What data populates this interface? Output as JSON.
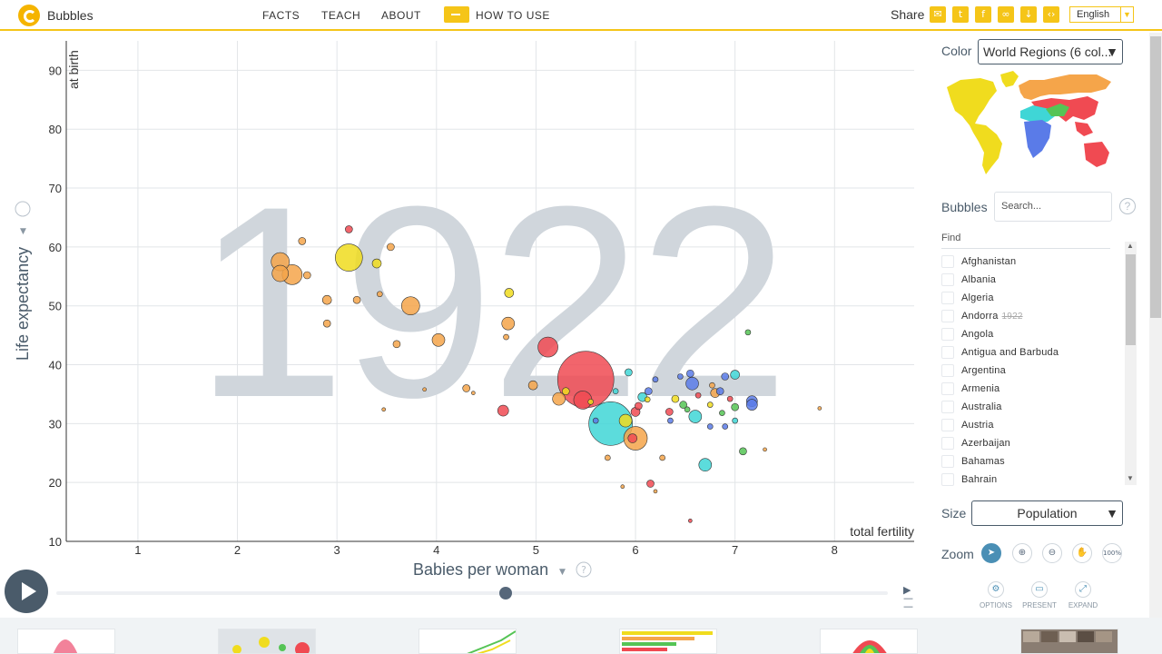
{
  "header": {
    "brand": "Bubbles",
    "nav": [
      "FACTS",
      "TEACH",
      "ABOUT"
    ],
    "howto": "HOW TO USE",
    "share": "Share",
    "share_icons": [
      "mail-icon",
      "twitter-icon",
      "facebook-icon",
      "link-icon",
      "download-icon",
      "embed-icon"
    ],
    "language": "English"
  },
  "chart_data": {
    "type": "scatter",
    "year": "1922",
    "xlabel": "Babies per woman",
    "xlabel_sub": "total fertility",
    "ylabel": "Life expectancy",
    "ylabel_sub": "at birth",
    "x_ticks": [
      "1",
      "2",
      "3",
      "4",
      "5",
      "6",
      "7",
      "8"
    ],
    "y_ticks": [
      "10",
      "20",
      "30",
      "40",
      "50",
      "60",
      "70",
      "80",
      "90"
    ],
    "xlim": [
      0.28,
      8.8
    ],
    "ylim": [
      10,
      95
    ],
    "region_colors": {
      "americas": "#f0dc1e",
      "europe": "#f5a54a",
      "africa": "#3fd6d6",
      "asia": "#f04a52",
      "east_asia": "#f04a52",
      "oceania": "#5a7be8",
      "mena": "#3fd6d6",
      "south_asia": "#55c455"
    },
    "bubbles": [
      {
        "x": 5.5,
        "y": 37.5,
        "r": 31,
        "c": "#f04a52"
      },
      {
        "x": 5.75,
        "y": 30,
        "r": 24,
        "c": "#3fd6d6"
      },
      {
        "x": 3.12,
        "y": 58.2,
        "r": 15,
        "c": "#f0dc1e"
      },
      {
        "x": 5.12,
        "y": 43,
        "r": 11,
        "c": "#f04a52"
      },
      {
        "x": 5.47,
        "y": 34,
        "r": 10,
        "c": "#f04a52"
      },
      {
        "x": 6.0,
        "y": 27.5,
        "r": 13,
        "c": "#f5a54a"
      },
      {
        "x": 2.43,
        "y": 57.5,
        "r": 10,
        "c": "#f5a54a"
      },
      {
        "x": 2.55,
        "y": 55.3,
        "r": 11,
        "c": "#f5a54a"
      },
      {
        "x": 2.43,
        "y": 55.5,
        "r": 9,
        "c": "#f5a54a"
      },
      {
        "x": 3.74,
        "y": 50,
        "r": 10,
        "c": "#f5a54a"
      },
      {
        "x": 4.02,
        "y": 44.2,
        "r": 7,
        "c": "#f5a54a"
      },
      {
        "x": 4.72,
        "y": 47,
        "r": 7,
        "c": "#f5a54a"
      },
      {
        "x": 4.73,
        "y": 52.2,
        "r": 5,
        "c": "#f0dc1e"
      },
      {
        "x": 3.4,
        "y": 57.2,
        "r": 5,
        "c": "#f0dc1e"
      },
      {
        "x": 2.9,
        "y": 51,
        "r": 5,
        "c": "#f5a54a"
      },
      {
        "x": 2.9,
        "y": 47,
        "r": 4,
        "c": "#f5a54a"
      },
      {
        "x": 2.65,
        "y": 61,
        "r": 4,
        "c": "#f5a54a"
      },
      {
        "x": 3.54,
        "y": 60,
        "r": 4,
        "c": "#f5a54a"
      },
      {
        "x": 3.12,
        "y": 63,
        "r": 4,
        "c": "#f04a52"
      },
      {
        "x": 3.2,
        "y": 51,
        "r": 4,
        "c": "#f5a54a"
      },
      {
        "x": 3.6,
        "y": 43.5,
        "r": 4,
        "c": "#f5a54a"
      },
      {
        "x": 4.67,
        "y": 32.2,
        "r": 6,
        "c": "#f04a52"
      },
      {
        "x": 5.23,
        "y": 34.2,
        "r": 7,
        "c": "#f5a54a"
      },
      {
        "x": 4.97,
        "y": 36.5,
        "r": 5,
        "c": "#f5a54a"
      },
      {
        "x": 4.3,
        "y": 36,
        "r": 4,
        "c": "#f5a54a"
      },
      {
        "x": 6.7,
        "y": 23,
        "r": 7,
        "c": "#3fd6d6"
      },
      {
        "x": 6.57,
        "y": 36.8,
        "r": 7,
        "c": "#5a7be8"
      },
      {
        "x": 7.17,
        "y": 33.8,
        "r": 6,
        "c": "#5a7be8"
      },
      {
        "x": 6.6,
        "y": 31.2,
        "r": 7,
        "c": "#3fd6d6"
      },
      {
        "x": 5.9,
        "y": 30.5,
        "r": 7,
        "c": "#f0dc1e"
      },
      {
        "x": 5.97,
        "y": 27.5,
        "r": 5,
        "c": "#f04a52"
      },
      {
        "x": 6.0,
        "y": 32,
        "r": 5,
        "c": "#f04a52"
      },
      {
        "x": 6.03,
        "y": 33,
        "r": 4,
        "c": "#f04a52"
      },
      {
        "x": 6.07,
        "y": 34.5,
        "r": 5,
        "c": "#3fd6d6"
      },
      {
        "x": 6.34,
        "y": 32,
        "r": 4,
        "c": "#f04a52"
      },
      {
        "x": 6.8,
        "y": 35.2,
        "r": 5,
        "c": "#f5a54a"
      },
      {
        "x": 7.0,
        "y": 38.3,
        "r": 5,
        "c": "#3fd6d6"
      },
      {
        "x": 6.9,
        "y": 38,
        "r": 4,
        "c": "#5a7be8"
      },
      {
        "x": 6.85,
        "y": 35.5,
        "r": 4,
        "c": "#5a7be8"
      },
      {
        "x": 6.55,
        "y": 38.5,
        "r": 4,
        "c": "#5a7be8"
      },
      {
        "x": 6.45,
        "y": 38,
        "r": 3,
        "c": "#5a7be8"
      },
      {
        "x": 6.2,
        "y": 37.5,
        "r": 3,
        "c": "#5a7be8"
      },
      {
        "x": 6.13,
        "y": 35.5,
        "r": 4,
        "c": "#5a7be8"
      },
      {
        "x": 5.93,
        "y": 38.7,
        "r": 4,
        "c": "#3fd6d6"
      },
      {
        "x": 6.48,
        "y": 33.2,
        "r": 4,
        "c": "#55c455"
      },
      {
        "x": 6.87,
        "y": 31.8,
        "r": 3,
        "c": "#55c455"
      },
      {
        "x": 7.0,
        "y": 32.8,
        "r": 4,
        "c": "#55c455"
      },
      {
        "x": 7.08,
        "y": 25.3,
        "r": 4,
        "c": "#55c455"
      },
      {
        "x": 7.13,
        "y": 45.5,
        "r": 3,
        "c": "#55c455"
      },
      {
        "x": 6.4,
        "y": 34.2,
        "r": 4,
        "c": "#f0dc1e"
      },
      {
        "x": 6.75,
        "y": 33.2,
        "r": 3,
        "c": "#f0dc1e"
      },
      {
        "x": 6.12,
        "y": 34.1,
        "r": 3,
        "c": "#f0dc1e"
      },
      {
        "x": 6.77,
        "y": 36.5,
        "r": 3,
        "c": "#f5a54a"
      },
      {
        "x": 6.27,
        "y": 24.2,
        "r": 3,
        "c": "#f5a54a"
      },
      {
        "x": 5.72,
        "y": 24.2,
        "r": 3,
        "c": "#f5a54a"
      },
      {
        "x": 7.3,
        "y": 25.6,
        "r": 2,
        "c": "#f5a54a"
      },
      {
        "x": 7.85,
        "y": 32.6,
        "r": 2,
        "c": "#f5a54a"
      },
      {
        "x": 6.55,
        "y": 13.5,
        "r": 2,
        "c": "#f04a52"
      },
      {
        "x": 6.15,
        "y": 19.8,
        "r": 4,
        "c": "#f04a52"
      },
      {
        "x": 6.2,
        "y": 18.5,
        "r": 2,
        "c": "#f5a54a"
      },
      {
        "x": 5.87,
        "y": 19.3,
        "r": 2,
        "c": "#f5a54a"
      },
      {
        "x": 7.17,
        "y": 33.2,
        "r": 6,
        "c": "#5a7be8"
      },
      {
        "x": 6.52,
        "y": 32.4,
        "r": 3,
        "c": "#55c455"
      },
      {
        "x": 6.9,
        "y": 29.5,
        "r": 3,
        "c": "#5a7be8"
      },
      {
        "x": 7.0,
        "y": 30.5,
        "r": 3,
        "c": "#3fd6d6"
      },
      {
        "x": 5.3,
        "y": 35.5,
        "r": 4,
        "c": "#f0dc1e"
      },
      {
        "x": 5.55,
        "y": 33.7,
        "r": 3,
        "c": "#f0dc1e"
      },
      {
        "x": 4.7,
        "y": 44.7,
        "r": 3,
        "c": "#f5a54a"
      },
      {
        "x": 2.7,
        "y": 55.2,
        "r": 4,
        "c": "#f5a54a"
      },
      {
        "x": 3.43,
        "y": 52,
        "r": 3,
        "c": "#f5a54a"
      },
      {
        "x": 4.37,
        "y": 35.2,
        "r": 2,
        "c": "#f5a54a"
      },
      {
        "x": 3.47,
        "y": 32.4,
        "r": 2,
        "c": "#f5a54a"
      },
      {
        "x": 3.88,
        "y": 35.8,
        "r": 2,
        "c": "#f5a54a"
      },
      {
        "x": 5.8,
        "y": 35.5,
        "r": 3,
        "c": "#3fd6d6"
      },
      {
        "x": 5.6,
        "y": 30.5,
        "r": 3,
        "c": "#5a7be8"
      },
      {
        "x": 6.35,
        "y": 30.5,
        "r": 3,
        "c": "#5a7be8"
      },
      {
        "x": 6.75,
        "y": 29.5,
        "r": 3,
        "c": "#5a7be8"
      },
      {
        "x": 6.95,
        "y": 34.2,
        "r": 3,
        "c": "#f04a52"
      },
      {
        "x": 6.63,
        "y": 34.8,
        "r": 3,
        "c": "#f04a52"
      }
    ]
  },
  "sidebar": {
    "color_label": "Color",
    "color_value": "World Regions (6 col...",
    "bubbles_label": "Bubbles",
    "search_placeholder": "Search...",
    "find_label": "Find",
    "countries": [
      "Afghanistan",
      "Albania",
      "Algeria",
      "Andorra",
      "Angola",
      "Antigua and Barbuda",
      "Argentina",
      "Armenia",
      "Australia",
      "Austria",
      "Azerbaijan",
      "Bahamas",
      "Bahrain"
    ],
    "andorra_year": "1922",
    "size_label": "Size",
    "size_value": "Population",
    "zoom_label": "Zoom",
    "zoom_reset": "100%",
    "tools": [
      "OPTIONS",
      "PRESENT",
      "EXPAND"
    ]
  },
  "timeline": {
    "progress": 0.54
  }
}
